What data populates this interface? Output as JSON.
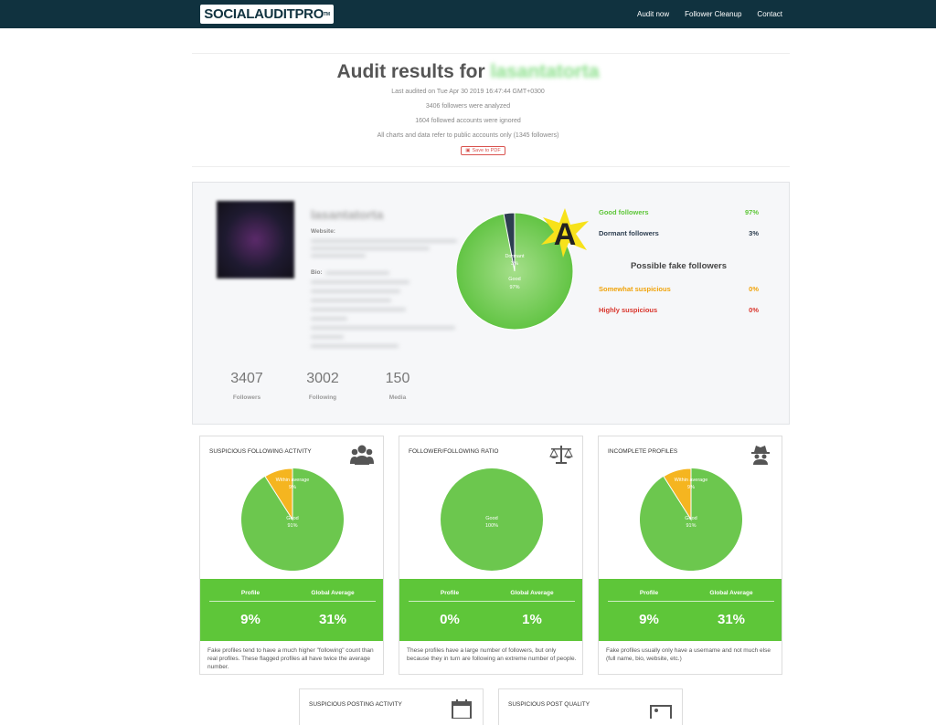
{
  "nav": {
    "logo": "SOCIALAUDITPRO",
    "logo_tm": "TM",
    "links": [
      "Audit now",
      "Follower Cleanup",
      "Contact"
    ]
  },
  "header": {
    "title_prefix": "Audit results for",
    "username": "lasantatorta",
    "last_audited": "Last audited on Tue Apr 30 2019 16:47:44 GMT+0300",
    "followers_analyzed": "3406 followers were analyzed",
    "ignored": "1604 followed accounts were ignored",
    "public_note": "All charts and data refer to public accounts only (1345 followers)",
    "pdf_label": "Save to PDF"
  },
  "profile": {
    "username": "lasantatorta",
    "website_label": "Website:",
    "bio_label": "Bio:",
    "stats": [
      {
        "value": "3407",
        "label": "Followers"
      },
      {
        "value": "3002",
        "label": "Following"
      },
      {
        "value": "150",
        "label": "Media"
      }
    ]
  },
  "main_chart": {
    "grade": "A",
    "labels": {
      "dormant": "Dormant",
      "dormant_pct": "3%",
      "good": "Good",
      "good_pct": "97%"
    },
    "legend": [
      {
        "label": "Good followers",
        "value": "97%",
        "color": "#5ec639"
      },
      {
        "label": "Dormant followers",
        "value": "3%",
        "color": "#2d3e50"
      }
    ],
    "fake_title": "Possible fake followers",
    "fake": [
      {
        "label": "Somewhat suspicious",
        "value": "0%",
        "color": "#f0a30a"
      },
      {
        "label": "Highly suspicious",
        "value": "0%",
        "color": "#d9342b"
      }
    ]
  },
  "cards": [
    {
      "title": "SUSPICIOUS FOLLOWING ACTIVITY",
      "icon": "users-icon",
      "slices": [
        {
          "name": "Within average",
          "pct": "9%",
          "value": 9,
          "color": "#f5b520"
        },
        {
          "name": "Good",
          "pct": "91%",
          "value": 91,
          "color": "#6cc74e"
        }
      ],
      "profile_label": "Profile",
      "global_label": "Global Average",
      "profile": "9%",
      "global": "31%",
      "desc": "Fake profiles tend to have a much higher \"following\" count than real profiles. These flagged profiles all have twice the average number."
    },
    {
      "title": "FOLLOWER/FOLLOWING RATIO",
      "icon": "balance-scale-icon",
      "slices": [
        {
          "name": "Good",
          "pct": "100%",
          "value": 100,
          "color": "#6cc74e"
        }
      ],
      "profile_label": "Profile",
      "global_label": "Global Average",
      "profile": "0%",
      "global": "1%",
      "desc": "These profiles have a large number of followers, but only because they in turn are following an extreme number of people."
    },
    {
      "title": "INCOMPLETE PROFILES",
      "icon": "incognito-icon",
      "slices": [
        {
          "name": "Within average",
          "pct": "9%",
          "value": 9,
          "color": "#f5b520"
        },
        {
          "name": "Good",
          "pct": "91%",
          "value": 91,
          "color": "#6cc74e"
        }
      ],
      "profile_label": "Profile",
      "global_label": "Global Average",
      "profile": "9%",
      "global": "31%",
      "desc": "Fake profiles usually only have a username and not much else (full name, bio, website, etc.)"
    }
  ],
  "cards_row2": [
    {
      "title": "SUSPICIOUS POSTING ACTIVITY",
      "icon": "calendar-icon"
    },
    {
      "title": "SUSPICIOUS POST QUALITY",
      "icon": "image-icon"
    }
  ]
}
